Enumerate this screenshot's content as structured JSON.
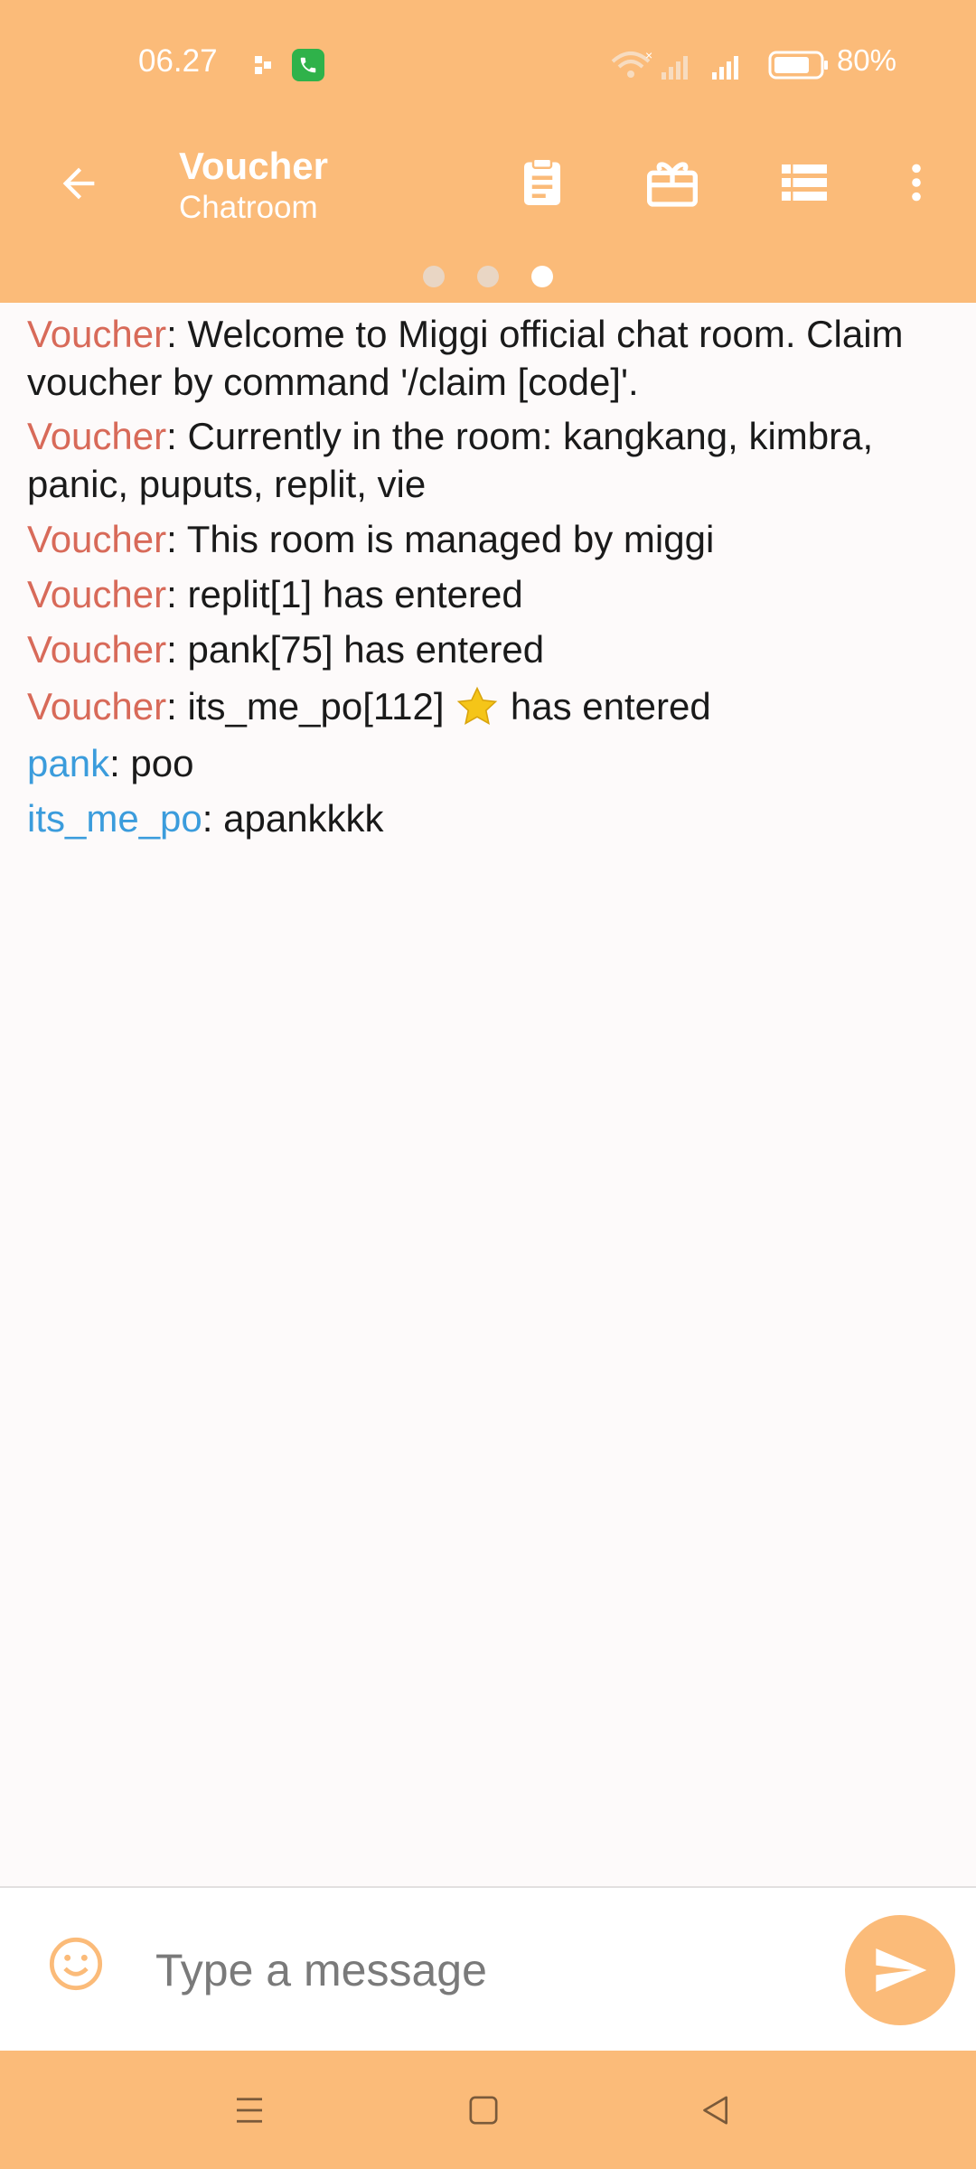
{
  "status_bar": {
    "time": "06.27",
    "battery": "80%"
  },
  "app_bar": {
    "title": "Voucher",
    "subtitle": "Chatroom",
    "page_indicator": {
      "count": 3,
      "active_index": 2
    }
  },
  "messages": [
    {
      "sender": "Voucher",
      "type": "system",
      "text": ": Welcome to Miggi official chat room. Claim voucher by command '/claim [code]'."
    },
    {
      "sender": "Voucher",
      "type": "system",
      "text": ": Currently in the room: kangkang, kimbra, panic, puputs, replit, vie"
    },
    {
      "sender": "Voucher",
      "type": "system",
      "text": ": This room is managed by miggi"
    },
    {
      "sender": "Voucher",
      "type": "system",
      "text": ": replit[1] has entered"
    },
    {
      "sender": "Voucher",
      "type": "system",
      "text": ": pank[75] has entered"
    },
    {
      "sender": "Voucher",
      "type": "system",
      "text_before": ": its_me_po[112] ",
      "text_after": " has entered"
    },
    {
      "sender": "pank",
      "type": "user",
      "text": ": poo"
    },
    {
      "sender": "its_me_po",
      "type": "user",
      "text": ": apankkkk"
    }
  ],
  "input": {
    "placeholder": "Type a message"
  },
  "colors": {
    "accent": "#fbbb79",
    "system_sender": "#d86a59",
    "user_sender": "#3b9cdc",
    "background": "#fdfafa"
  },
  "icons": {
    "back": "arrow-left-icon",
    "clipboard": "clipboard-icon",
    "gift": "gift-icon",
    "list": "list-icon",
    "more": "more-vert-icon",
    "emoji": "smiley-icon",
    "send": "send-icon",
    "star": "star-icon"
  }
}
